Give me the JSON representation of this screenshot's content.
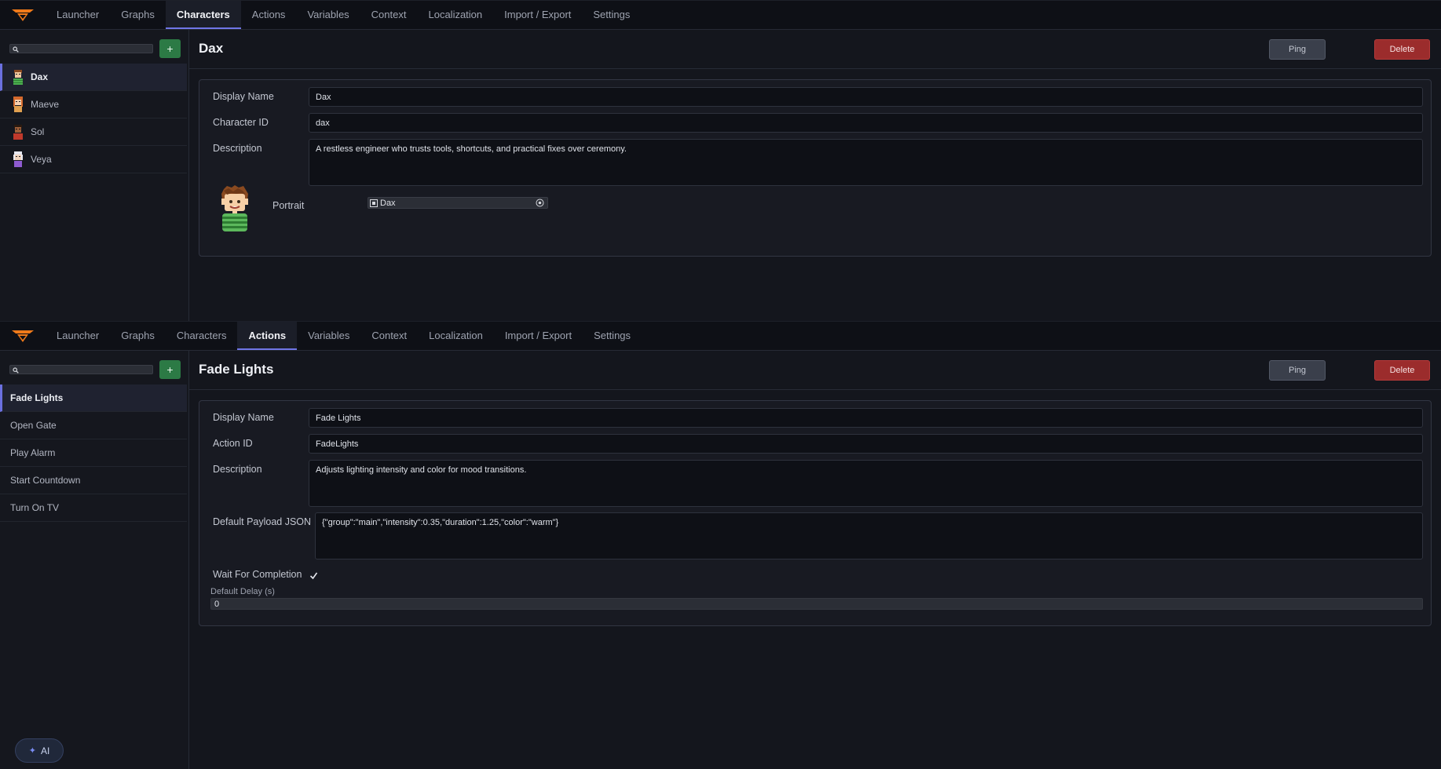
{
  "nav": {
    "tabs": [
      "Launcher",
      "Graphs",
      "Characters",
      "Actions",
      "Variables",
      "Context",
      "Localization",
      "Import / Export",
      "Settings"
    ]
  },
  "characters_view": {
    "active_tab": "Characters",
    "search": {
      "value": "",
      "placeholder": ""
    },
    "add_label": "+",
    "list": [
      {
        "label": "Dax",
        "selected": true
      },
      {
        "label": "Maeve",
        "selected": false
      },
      {
        "label": "Sol",
        "selected": false
      },
      {
        "label": "Veya",
        "selected": false
      }
    ],
    "title": "Dax",
    "ping_label": "Ping",
    "delete_label": "Delete",
    "form": {
      "display_name_label": "Display Name",
      "display_name_value": "Dax",
      "id_label": "Character ID",
      "id_value": "dax",
      "description_label": "Description",
      "description_value": "A restless engineer who trusts tools, shortcuts, and practical fixes over ceremony.",
      "portrait_label": "Portrait",
      "portrait_value": "Dax"
    }
  },
  "actions_view": {
    "active_tab": "Actions",
    "search": {
      "value": "",
      "placeholder": ""
    },
    "add_label": "+",
    "list": [
      {
        "label": "Fade Lights",
        "selected": true
      },
      {
        "label": "Open Gate",
        "selected": false
      },
      {
        "label": "Play Alarm",
        "selected": false
      },
      {
        "label": "Start Countdown",
        "selected": false
      },
      {
        "label": "Turn On TV",
        "selected": false
      }
    ],
    "title": "Fade Lights",
    "ping_label": "Ping",
    "delete_label": "Delete",
    "form": {
      "display_name_label": "Display Name",
      "display_name_value": "Fade Lights",
      "id_label": "Action ID",
      "id_value": "FadeLights",
      "description_label": "Description",
      "description_value": "Adjusts lighting intensity and color for mood transitions.",
      "payload_label": "Default Payload JSON",
      "payload_value": "{\"group\":\"main\",\"intensity\":0.35,\"duration\":1.25,\"color\":\"warm\"}",
      "wait_label": "Wait For Completion",
      "wait_checked": true,
      "delay_label": "Default Delay (s)",
      "delay_value": "0"
    }
  },
  "ai_button": {
    "label": "AI"
  },
  "colors": {
    "accent": "#6b70e0",
    "add_green": "#2c7a45",
    "delete_red": "#9b2c2c",
    "logo_orange": "#f07a1a"
  }
}
